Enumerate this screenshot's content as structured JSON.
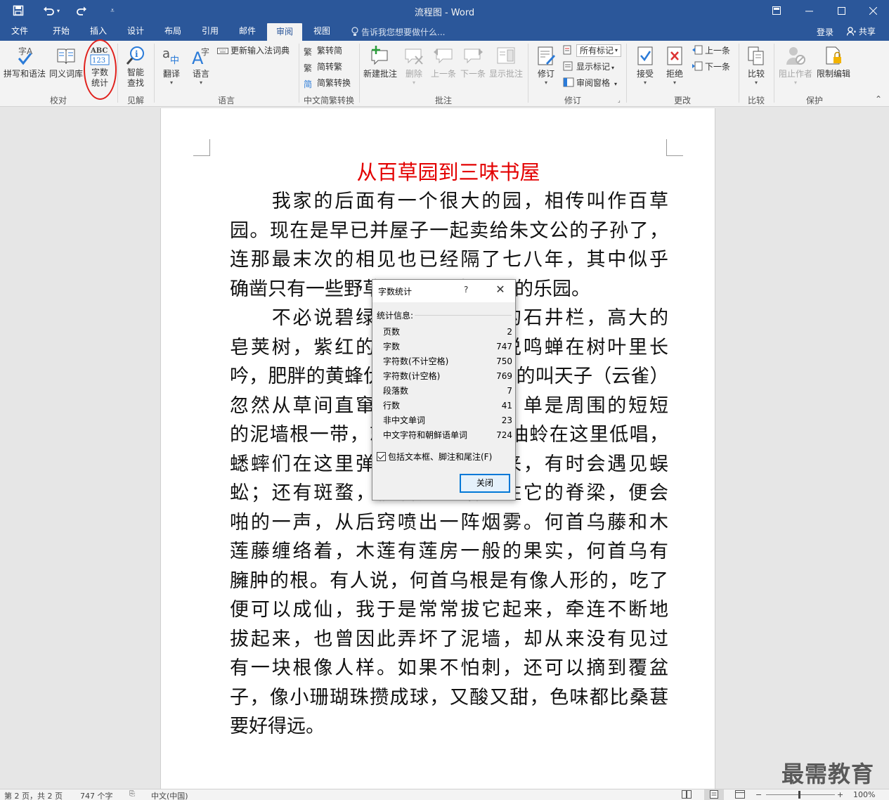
{
  "window": {
    "title": "流程图 - Word",
    "quick_access": [
      "save-icon",
      "undo-icon",
      "redo-icon",
      "customize-icon"
    ],
    "controls": [
      "ribbon-display-icon",
      "minimize-icon",
      "maximize-icon",
      "close-icon"
    ]
  },
  "tabs": [
    {
      "label": "文件",
      "active": false
    },
    {
      "label": "开始",
      "active": false
    },
    {
      "label": "插入",
      "active": false
    },
    {
      "label": "设计",
      "active": false
    },
    {
      "label": "布局",
      "active": false
    },
    {
      "label": "引用",
      "active": false
    },
    {
      "label": "邮件",
      "active": false
    },
    {
      "label": "审阅",
      "active": true
    },
    {
      "label": "视图",
      "active": false
    }
  ],
  "tellme": "告诉我您想要做什么...",
  "login": "登录",
  "share": "共享",
  "ribbon": {
    "proofing": {
      "spell": "拼写和语法",
      "thesaurus": "同义词库",
      "wordcount1": "字数",
      "wordcount2": "统计",
      "group": "校对"
    },
    "insights": {
      "smart1": "智能",
      "smart2": "查找",
      "group": "见解"
    },
    "language": {
      "translate": "翻译",
      "language": "语言",
      "update_ime": "更新输入法词典",
      "group": "语言"
    },
    "chinese": {
      "t2s": "繁转简",
      "s2t": "简转繁",
      "convert": "简繁转换",
      "group": "中文简繁转换"
    },
    "comments": {
      "new": "新建批注",
      "delete": "删除",
      "prev": "上一条",
      "next": "下一条",
      "show": "显示批注",
      "group": "批注"
    },
    "tracking": {
      "track": "修订",
      "markup": "所有标记",
      "show_markup": "显示标记",
      "pane": "审阅窗格",
      "group": "修订"
    },
    "changes": {
      "accept": "接受",
      "reject": "拒绝",
      "prev": "上一条",
      "next": "下一条",
      "group": "更改"
    },
    "compare": {
      "compare": "比较",
      "group": "比较"
    },
    "protect": {
      "block": "阻止作者",
      "restrict": "限制编辑",
      "group": "保护"
    }
  },
  "document": {
    "title": "从百草园到三味书屋",
    "lines": [
      "　　我家的后面有一个很大的园，相传叫作百草",
      "园。现在是早已并屋子一起卖给朱文公的子孙了，",
      "连那最末次的相见也已经隔了七八年，其中似乎",
      "确凿只有一些野草；但那时却是我的乐园。",
      "　　不必说碧绿的菜畦，光滑的石井栏，高大的",
      "皂荚树，紫红的桑葚；也不必说鸣蝉在树叶里长",
      "吟，肥胖的黄蜂伏在菜花上，轻捷的叫天子（云雀）",
      "忽然从草间直窜向云霄里去了。单是周围的短短",
      "的泥墙根一带，就有无限趣味。油蛉在这里低唱，",
      "蟋蟀们在这里弹琴。翻开断砖来，有时会遇见蜈",
      "蚣；还有斑蝥，倘若用手指按住它的脊梁，便会",
      "啪的一声，从后窍喷出一阵烟雾。何首乌藤和木",
      "莲藤缠络着，木莲有莲房一般的果实，何首乌有",
      "臃肿的根。有人说，何首乌根是有像人形的，吃了",
      "便可以成仙，我于是常常拔它起来，牵连不断地",
      "拔起来，也曾因此弄坏了泥墙，却从来没有见过",
      "有一块根像人样。如果不怕刺，还可以摘到覆盆",
      "子，像小珊瑚珠攒成球，又酸又甜，色味都比桑葚",
      "要好得远。"
    ]
  },
  "dialog": {
    "title": "字数统计",
    "help": "?",
    "section": "统计信息:",
    "stats": [
      {
        "label": "页数",
        "value": "2"
      },
      {
        "label": "字数",
        "value": "747"
      },
      {
        "label": "字符数(不计空格)",
        "value": "750"
      },
      {
        "label": "字符数(计空格)",
        "value": "769"
      },
      {
        "label": "段落数",
        "value": "7"
      },
      {
        "label": "行数",
        "value": "41"
      },
      {
        "label": "非中文单词",
        "value": "23"
      },
      {
        "label": "中文字符和朝鲜语单词",
        "value": "724"
      }
    ],
    "checkbox": "包括文本框、脚注和尾注(F)",
    "checked": true,
    "close": "关闭"
  },
  "status": {
    "page": "第 2 页，共 2 页",
    "words": "747 个字",
    "lang": "中文(中国)",
    "zoom": "100%"
  },
  "watermark": "最需教育",
  "colors": {
    "brand": "#2b579a",
    "title_red": "#e30000",
    "annotation_red": "#e0201c"
  }
}
